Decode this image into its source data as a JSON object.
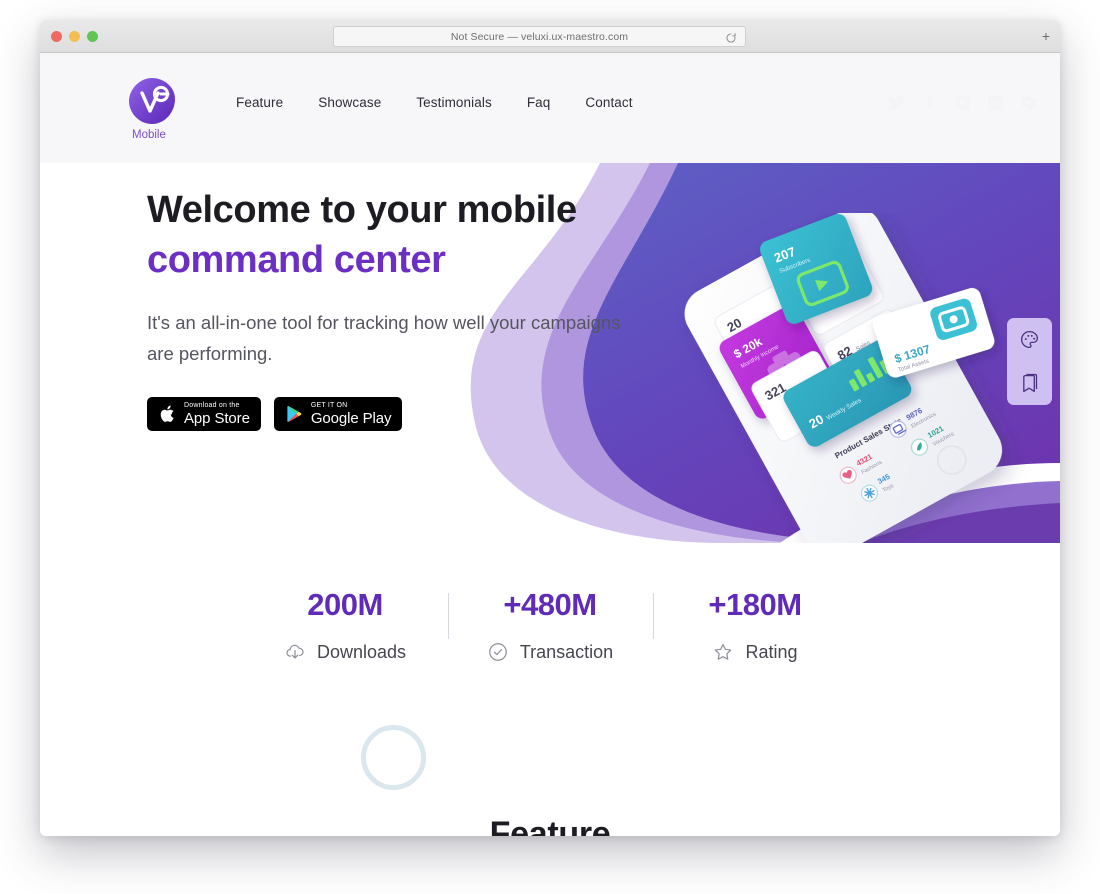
{
  "browser": {
    "url_text": "Not Secure — veluxi.ux-maestro.com",
    "reload_icon": "reload-icon",
    "new_tab_label": "+",
    "traffic_lights": [
      "close",
      "minimize",
      "zoom"
    ]
  },
  "header": {
    "brand": {
      "mark_text": "Ve",
      "label": "Mobile"
    },
    "nav": [
      {
        "label": "Feature"
      },
      {
        "label": "Showcase"
      },
      {
        "label": "Testimonials"
      },
      {
        "label": "Faq"
      },
      {
        "label": "Contact"
      }
    ],
    "social": [
      {
        "name": "twitter-icon"
      },
      {
        "name": "facebook-icon"
      },
      {
        "name": "dribbble-icon"
      },
      {
        "name": "linkedin-icon"
      },
      {
        "name": "gear-icon"
      }
    ]
  },
  "hero": {
    "title_line1": "Welcome to your mobile",
    "title_line2": "command center",
    "subtitle": "It's an all-in-one tool for tracking how well your campaigns are performing.",
    "badges": [
      {
        "small": "Download on the",
        "big": "App Store",
        "icon": "apple-icon"
      },
      {
        "small": "GET IT ON",
        "big": "Google Play",
        "icon": "google-play-icon"
      }
    ],
    "colors": {
      "purple_top": "#5b5bc0",
      "purple_bottom": "#6e39b0",
      "purple_light": "#b49ee0",
      "accent": "#6c2fc4"
    },
    "side_widget": {
      "icons": [
        {
          "name": "palette-icon"
        },
        {
          "name": "bookmark-icon"
        }
      ]
    },
    "phone_mockup": {
      "cards": [
        {
          "value": "$ 20k",
          "label": "Monthly Income",
          "color": "#b52fd1"
        },
        {
          "value": "20",
          "label": "Weekly Sales",
          "color": "#ffffff"
        },
        {
          "value": "321",
          "label": "",
          "color": "#ffffff"
        },
        {
          "value": "82",
          "label": "Sales",
          "color": "#ffffff"
        },
        {
          "value": "20",
          "label": "Weekly Sales",
          "color": "#35b6cc"
        },
        {
          "value": "207",
          "label": "Subscribers",
          "color": "#2fa8bf"
        },
        {
          "value": "$ 1307",
          "label": "Total Assets",
          "color": "#ffffff"
        }
      ],
      "stats_title": "Product Sales Stats",
      "stats": [
        {
          "value": "9876",
          "label": "Electronics"
        },
        {
          "value": "1021",
          "label": "Vouchers"
        },
        {
          "value": "4321",
          "label": "Fashions"
        },
        {
          "value": "345",
          "label": "Toys"
        }
      ]
    }
  },
  "stats_section": [
    {
      "value": "200M",
      "label": "Downloads",
      "icon": "cloud-download-icon"
    },
    {
      "value": "+480M",
      "label": "Transaction",
      "icon": "check-circle-icon"
    },
    {
      "value": "+180M",
      "label": "Rating",
      "icon": "star-icon"
    }
  ],
  "feature_section": {
    "heading": "Feature",
    "loader": "loading-spinner"
  }
}
